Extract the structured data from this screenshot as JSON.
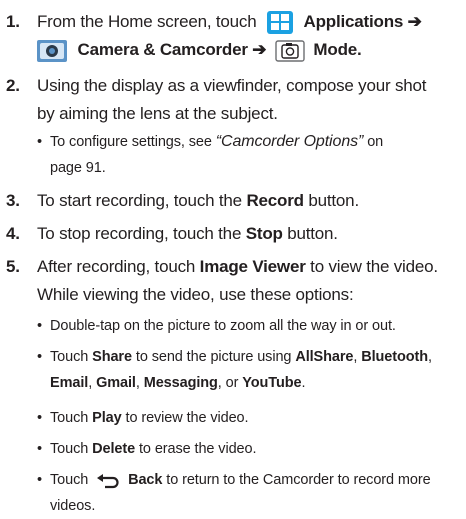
{
  "steps": [
    {
      "num": "1.",
      "l1_a": "From the Home screen, touch",
      "l1_b": "Applications ➔",
      "l2_a": "Camera & Camcorder ➔",
      "l2_b": "Mode."
    },
    {
      "num": "2.",
      "l1": "Using the display as a viewfinder, compose your shot",
      "l2": "by aiming the lens at the subject."
    },
    {
      "num": "3.",
      "a": "To start recording, touch the",
      "b": "Record",
      "c": "button."
    },
    {
      "num": "4.",
      "a": "To stop recording, touch the",
      "b": "Stop",
      "c": "button."
    },
    {
      "num": "5.",
      "l1_a": "After recording, touch",
      "l1_b": "Image Viewer",
      "l1_c": "to view the video.",
      "l2": "While viewing the video, use these options:"
    }
  ],
  "bullet_char": "•",
  "step2_bullet": {
    "a": "To configure settings, see",
    "ref": "“Camcorder Options”",
    "b": "on",
    "l2": "page 91."
  },
  "step5_bullets": {
    "b1": "Double-tap on the picture to zoom all the way in or out.",
    "b2_a": "Touch",
    "b2_b": "Share",
    "b2_c": "to send the picture using",
    "b2_d": "AllShare",
    "b2_e": ",",
    "b2_f": "Bluetooth",
    "b2_g": ",",
    "b2_h": "Email",
    "b2_i": ",",
    "b2_j": "Gmail",
    "b2_k": ",",
    "b2_l": "Messaging",
    "b2_m": ", or",
    "b2_n": "YouTube",
    "b2_o": ".",
    "b3_a": "Touch",
    "b3_b": "Play",
    "b3_c": "to review the video.",
    "b4_a": "Touch",
    "b4_b": "Delete",
    "b4_c": "to erase the video.",
    "b5_a": "Touch",
    "b5_b": "Back",
    "b5_c": "to return to the Camcorder to record more",
    "b5_l2": "videos."
  },
  "icons": {
    "applications": "applications-grid-icon",
    "camera": "camera-app-icon",
    "mode": "camera-mode-icon",
    "back": "back-arrow-icon",
    "applications_color": "#1ba1e2",
    "camera_color": "#5b93c7"
  }
}
